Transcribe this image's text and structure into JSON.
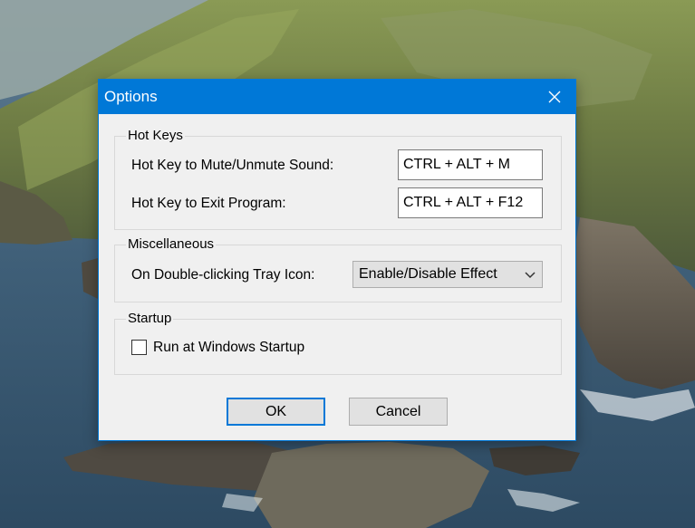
{
  "dialog": {
    "title": "Options",
    "close_icon": "close-icon"
  },
  "hot_keys": {
    "group_label": "Hot Keys",
    "mute_label": "Hot Key to Mute/Unmute Sound:",
    "mute_value": "CTRL + ALT + M",
    "exit_label": "Hot Key to Exit Program:",
    "exit_value": "CTRL + ALT + F12"
  },
  "misc": {
    "group_label": "Miscellaneous",
    "tray_label": "On Double-clicking Tray Icon:",
    "tray_selected": "Enable/Disable Effect",
    "dropdown_icon": "chevron-down-icon"
  },
  "startup": {
    "group_label": "Startup",
    "run_label": "Run at Windows Startup",
    "run_checked": false
  },
  "buttons": {
    "ok_label": "OK",
    "cancel_label": "Cancel"
  },
  "colors": {
    "accent": "#0078d7",
    "dialog_bg": "#f0f0f0",
    "button_bg": "#e1e1e1"
  }
}
